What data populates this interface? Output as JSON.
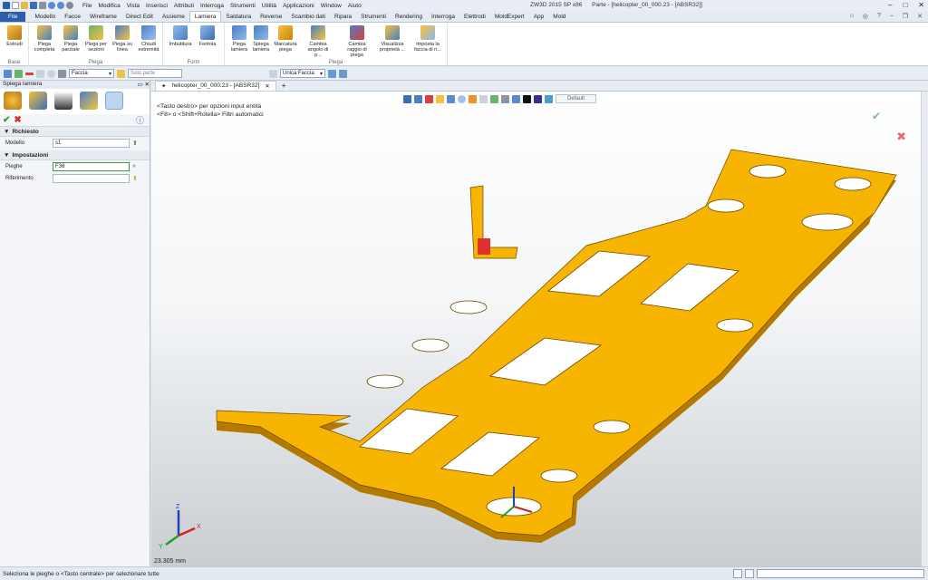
{
  "app": {
    "title": "ZW3D 2015 SP x86",
    "doc_title": "Parte - [helicopter_00_000.23 - [ABSR32]]"
  },
  "menu": [
    "File",
    "Modifica",
    "Vista",
    "Inserisci",
    "Attributi",
    "Interroga",
    "Strumenti",
    "Utilità",
    "Applicazioni",
    "Window",
    "Aiuto"
  ],
  "tabs": [
    "File",
    "Modello",
    "Facce",
    "Wireframe",
    "Direct Edit",
    "Assieme",
    "Lamiera",
    "Saldatura",
    "Reverse",
    "Scambio dati",
    "Ripara",
    "Strumenti",
    "Rendering",
    "Interroga",
    "Elettrodi",
    "MoldExpert",
    "App",
    "Mold"
  ],
  "active_tab": "Lamiera",
  "ribbon": {
    "groups": [
      {
        "label": "Base",
        "buttons": [
          "Estrudi"
        ]
      },
      {
        "label": "Piega",
        "buttons": [
          "Piega completa",
          "Piega parziale",
          "Piega per sezioni",
          "Piega su linea",
          "Chiudi estremità"
        ]
      },
      {
        "label": "Form",
        "buttons": [
          "Imbutitura",
          "Feritoia"
        ]
      },
      {
        "label": "Piega",
        "buttons": [
          "Piega lamiera",
          "Spiega lamiera",
          "Marcatura piega",
          "Cambia angolo di p...",
          "Cambia raggio di piega",
          "Visualizza proprietà ...",
          "Imposta la faccia di ri..."
        ]
      }
    ]
  },
  "toolbar": {
    "filter": "Faccia",
    "solo": "Solo parte",
    "face_mode": "Unica Faccia"
  },
  "panel": {
    "title": "Spiega lamiera",
    "sect_required": "Richiesto",
    "sect_settings": "Impostazioni",
    "modello_label": "Modello",
    "modello_value": "s1",
    "pieghe_label": "Pieghe",
    "pieghe_value": "F36",
    "riferimento_label": "Riferimento",
    "riferimento_value": ""
  },
  "document_tab": "helicopter_00_000.23 - [ABSR32]",
  "viewport": {
    "hint_line1": "<Tasto destro> per opzioni input entità",
    "hint_line2": "<F8> o <Shift+Rotella> Filtri automatici",
    "style": "Default",
    "scale": "23.305 mm",
    "axes": {
      "x": "X",
      "y": "Y",
      "z": "Z"
    }
  },
  "status_text": "Seleziona le pieghe o <Tasto centrale> per selezionare tutte",
  "colors": {
    "part": "#f5b000",
    "part_dark": "#c98600",
    "edge": "#5a3a00",
    "accent": "#2b5da8"
  }
}
